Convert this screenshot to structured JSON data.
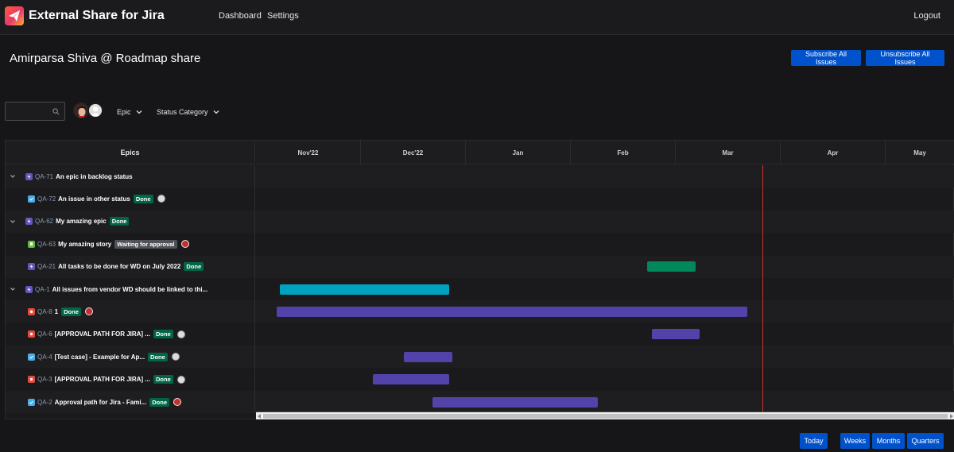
{
  "app": {
    "title": "External Share for Jira",
    "nav": [
      "Dashboard",
      "Settings"
    ],
    "logout": "Logout"
  },
  "page": {
    "title": "Amirparsa Shiva @ Roadmap share",
    "subscribe_all": "Subscribe All Issues",
    "unsubscribe_all": "Unsubscribe All Issues"
  },
  "filters": {
    "search_value": "",
    "epic": "Epic",
    "status_category": "Status Category"
  },
  "roadmap": {
    "epics_header": "Epics",
    "months": [
      "Nov'22",
      "Dec'22",
      "Jan",
      "Feb",
      "Mar",
      "Apr",
      "May"
    ],
    "rows": [
      {
        "level": 0,
        "type": "epic",
        "key": "QA-71",
        "summary": "An epic in backlog status",
        "status": "",
        "assignee": ""
      },
      {
        "level": 1,
        "type": "task",
        "key": "QA-72",
        "summary": "An issue in other status",
        "status": "Done",
        "assignee": "grey"
      },
      {
        "level": 0,
        "type": "epic",
        "key": "QA-62",
        "summary": "My amazing epic",
        "status": "Done",
        "assignee": ""
      },
      {
        "level": 1,
        "type": "story",
        "key": "QA-63",
        "summary": "My amazing story",
        "status": "Waiting for approval",
        "assignee": "face"
      },
      {
        "level": 1,
        "type": "epic",
        "key": "QA-21",
        "summary": "All tasks to be done for WD on July 2022",
        "status": "Done",
        "assignee": ""
      },
      {
        "level": 0,
        "type": "epic",
        "key": "QA-1",
        "summary": "All issues from vendor WD should be linked to thi...",
        "status": "",
        "assignee": ""
      },
      {
        "level": 1,
        "type": "bug",
        "key": "QA-8",
        "summary": "1",
        "status": "Done",
        "assignee": "face"
      },
      {
        "level": 1,
        "type": "bug",
        "key": "QA-6",
        "summary": "[APPROVAL PATH FOR JIRA] ...",
        "status": "Done",
        "assignee": "grey"
      },
      {
        "level": 1,
        "type": "task",
        "key": "QA-4",
        "summary": "[Test case] - Example for Ap...",
        "status": "Done",
        "assignee": "grey"
      },
      {
        "level": 1,
        "type": "bug",
        "key": "QA-3",
        "summary": "[APPROVAL PATH FOR JIRA] ...",
        "status": "Done",
        "assignee": "grey"
      },
      {
        "level": 1,
        "type": "task",
        "key": "QA-2",
        "summary": "Approval path for Jira - Fami...",
        "status": "Done",
        "assignee": "face"
      }
    ],
    "bars": [
      {
        "row": 4,
        "start": 3.73,
        "end": 4.19,
        "color": "#00875a"
      },
      {
        "row": 5,
        "start": 0.23,
        "end": 1.84,
        "color": "#00a3bf"
      },
      {
        "row": 6,
        "start": 0.2,
        "end": 4.68,
        "color": "#5243aa"
      },
      {
        "row": 7,
        "start": 3.77,
        "end": 4.23,
        "color": "#5243aa"
      },
      {
        "row": 8,
        "start": 1.41,
        "end": 1.87,
        "color": "#5243aa"
      },
      {
        "row": 9,
        "start": 1.11,
        "end": 1.84,
        "color": "#5243aa"
      },
      {
        "row": 10,
        "start": 1.68,
        "end": 3.26,
        "color": "#5243aa"
      }
    ],
    "today_label": "Today",
    "zoom": [
      "Weeks",
      "Months",
      "Quarters"
    ]
  },
  "colors": {
    "accent": "#0052cc",
    "done": "#006644",
    "epic": "#6554c0",
    "task": "#4bade8",
    "story": "#63ba3c",
    "bug": "#e5493a",
    "today_line": "#c9372c"
  }
}
